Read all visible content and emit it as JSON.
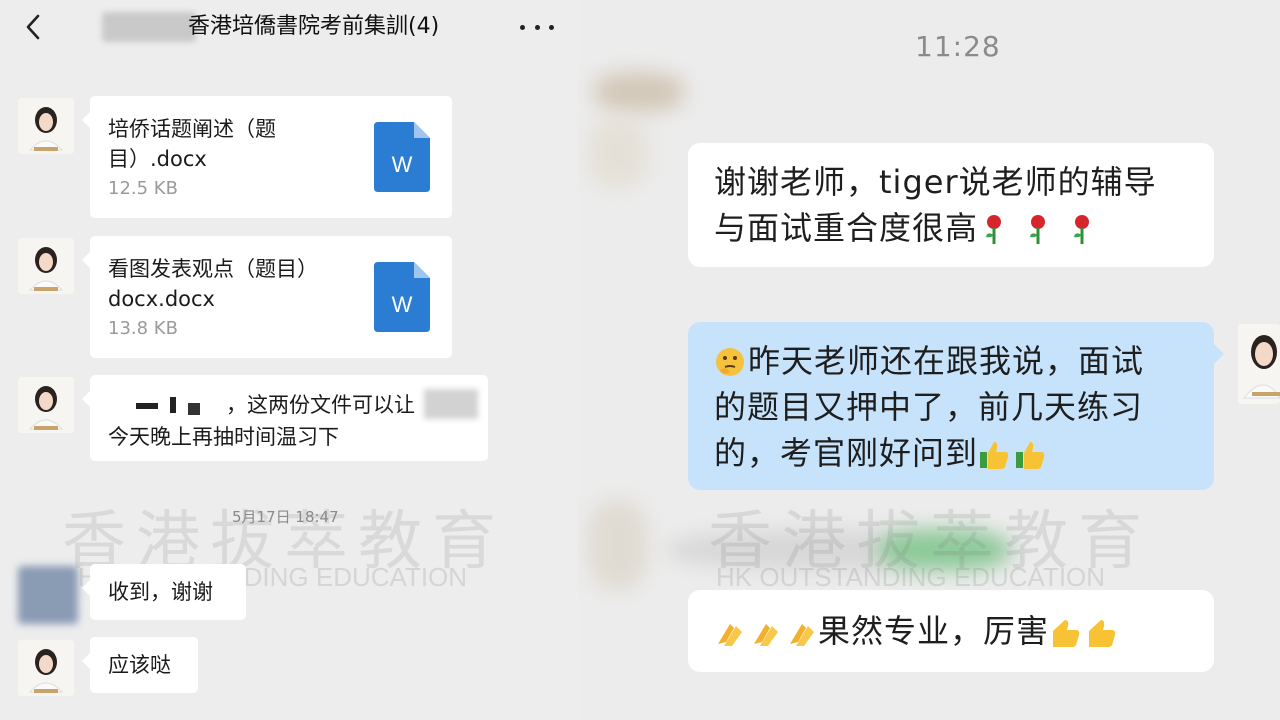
{
  "left_chat": {
    "header": {
      "title": "香港培僑書院考前集訓(4)",
      "back_icon": "chevron-left-icon",
      "more_icon": "more-horizontal-icon"
    },
    "messages": [
      {
        "type": "file",
        "file_name": "培侨话题阐述（题目）.docx",
        "file_size": "12.5 KB",
        "icon": "word-doc-icon",
        "icon_letter": "W"
      },
      {
        "type": "file",
        "file_name": "看图发表观点（题目）docx.docx",
        "file_size": "13.8 KB",
        "icon": "word-doc-icon",
        "icon_letter": "W"
      },
      {
        "type": "text",
        "line1": "，这两份文件可以让",
        "line2": "今天晚上再抽时间温习下"
      },
      {
        "type": "text",
        "line1": "收到，谢谢"
      },
      {
        "type": "text",
        "line1": "应该哒"
      }
    ],
    "timestamp": "5月17日 18:47"
  },
  "watermark": {
    "zh": "香港拔萃教育",
    "en": "HK OUTSTANDING EDUCATION"
  },
  "right_chat": {
    "time": "11:28",
    "messages": [
      {
        "line1": "谢谢老师，tiger说老师的辅导",
        "line2": "与面试重合度很高"
      },
      {
        "line1": "昨天老师还在跟我说，面试",
        "line2": "的题目又押中了，前几天练习",
        "line3": "的，考官刚好问到"
      },
      {
        "line1": "果然专业，厉害"
      }
    ]
  },
  "colors": {
    "bg": "#ededed",
    "bubble": "#ffffff",
    "blue_bubble": "#c7e3fb",
    "word_blue": "#2b7cd3"
  }
}
